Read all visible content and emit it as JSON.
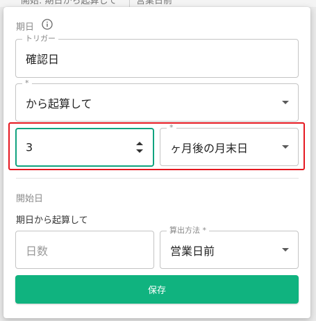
{
  "background": {
    "left_text": "開始: 期日から起算して",
    "right_text": "営業日前"
  },
  "due_date": {
    "section_title": "期日",
    "trigger_field": {
      "label": "トリガー",
      "value": "確認日"
    },
    "base_select": {
      "label": "*",
      "value": "から起算して"
    },
    "number_input": {
      "value": "3"
    },
    "unit_select": {
      "label": "*",
      "value": "ヶ月後の月末日"
    }
  },
  "start_date": {
    "section_title": "開始日",
    "description": "期日から起算して",
    "days_input": {
      "placeholder": "日数"
    },
    "method_select": {
      "label": "算出方法 *",
      "value": "営業日前"
    }
  },
  "actions": {
    "save_label": "保存"
  },
  "colors": {
    "accent": "#10b37f",
    "focus_border": "#10a37f",
    "highlight": "#e5171f"
  },
  "icons": {
    "info": "info-circle-icon",
    "dropdown": "caret-down-icon",
    "spinner": "number-spinner-icon"
  }
}
